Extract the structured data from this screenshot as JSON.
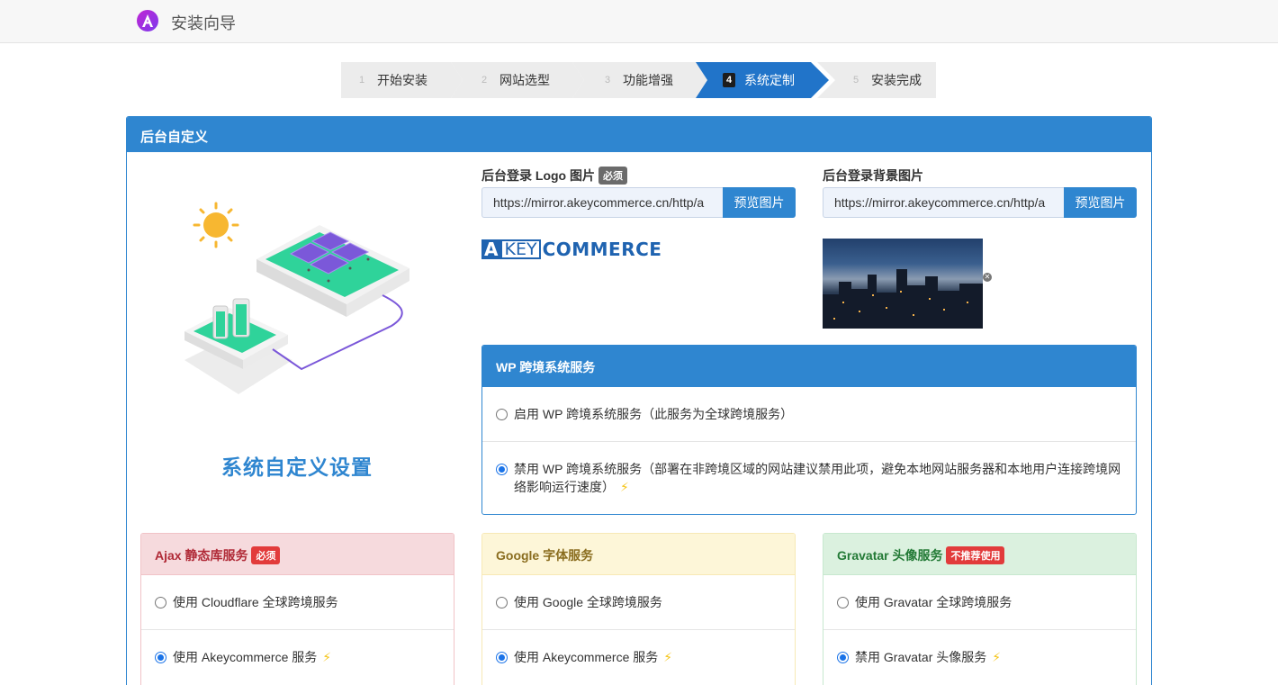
{
  "header": {
    "title": "安装向导",
    "logo_icon": "app-logo-a-icon"
  },
  "steps": [
    {
      "num": "1",
      "label": "开始安装",
      "active": false
    },
    {
      "num": "2",
      "label": "网站选型",
      "active": false
    },
    {
      "num": "3",
      "label": "功能增强",
      "active": false
    },
    {
      "num": "4",
      "label": "系统定制",
      "active": true
    },
    {
      "num": "5",
      "label": "安装完成",
      "active": false
    }
  ],
  "panel": {
    "title": "后台自定义"
  },
  "illustration": {
    "title": "系统自定义设置"
  },
  "logo_field": {
    "label": "后台登录 Logo 图片",
    "tag": "必须",
    "value": "https://mirror.akeycommerce.cn/http/a",
    "button": "预览图片",
    "preview": {
      "a": "A",
      "key": "KEY",
      "commerce": "COMMERCE"
    }
  },
  "bg_field": {
    "label": "后台登录背景图片",
    "value": "https://mirror.akeycommerce.cn/http/a",
    "button": "预览图片"
  },
  "wp_card": {
    "title": "WP 跨境系统服务",
    "options": [
      {
        "label": "启用 WP 跨境系统服务（此服务为全球跨境服务）",
        "checked": false
      },
      {
        "label": "禁用 WP 跨境系统服务（部署在非跨境区域的网站建议禁用此项，避免本地网站服务器和本地用户连接跨境网络影响运行速度）",
        "checked": true
      }
    ]
  },
  "ajax_card": {
    "title": "Ajax 静态库服务",
    "tag": "必须",
    "options": [
      {
        "label": "使用 Cloudflare 全球跨境服务",
        "checked": false
      },
      {
        "label": "使用 Akeycommerce 服务",
        "checked": true
      }
    ]
  },
  "google_card": {
    "title": "Google 字体服务",
    "options": [
      {
        "label": "使用 Google 全球跨境服务",
        "checked": false
      },
      {
        "label": "使用 Akeycommerce 服务",
        "checked": true
      }
    ]
  },
  "gravatar_card": {
    "title": "Gravatar 头像服务",
    "tag": "不推荐使用",
    "options": [
      {
        "label": "使用 Gravatar 全球跨境服务",
        "checked": false
      },
      {
        "label": "禁用 Gravatar 头像服务",
        "checked": true
      }
    ]
  },
  "colors": {
    "primary": "#2f86d0",
    "active_step": "#2174c9",
    "bolt": "#f5c518"
  }
}
